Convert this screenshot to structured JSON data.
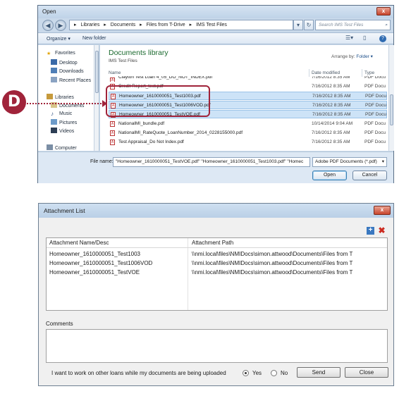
{
  "open_dialog": {
    "title": "Open",
    "close": "x",
    "address": [
      "Libraries",
      "Documents",
      "Files from T-Drive",
      "IMS Test Files"
    ],
    "search_placeholder": "Search IMS Test Files",
    "toolbar": {
      "organize": "Organize ▾",
      "new_folder": "New folder"
    },
    "nav": {
      "favorites": "Favorites",
      "desktop": "Desktop",
      "downloads": "Downloads",
      "recent": "Recent Places",
      "libraries": "Libraries",
      "documents": "Documents",
      "music": "Music",
      "pictures": "Pictures",
      "videos": "Videos",
      "computer": "Computer"
    },
    "library_title": "Documents library",
    "library_sub": "IMS Test Files",
    "arrange_label": "Arrange by:",
    "arrange_value": "Folder ▾",
    "columns": {
      "name": "Name",
      "date": "Date modified",
      "type": "Type"
    },
    "files": [
      {
        "name": "Clayton Test Loan 4_05_DO_NOT_INDEX.pdf",
        "date": "7/16/2012 8:35 AM",
        "type": "PDF Docu"
      },
      {
        "name": "Credit Report_test.pdf",
        "date": "7/16/2012 8:35 AM",
        "type": "PDF Docu"
      },
      {
        "name": "Homeowner_1610000051_Test1003.pdf",
        "date": "7/16/2012 8:35 AM",
        "type": "PDF Docu"
      },
      {
        "name": "Homeowner_1610000051_Test1006VOD.pdf",
        "date": "7/16/2012 8:35 AM",
        "type": "PDF Docu"
      },
      {
        "name": "Homeowner_1610000051_TestVOE.pdf",
        "date": "7/16/2012 8:35 AM",
        "type": "PDF Docu"
      },
      {
        "name": "NationalMI_bundle.pdf",
        "date": "10/14/2014 9:04 AM",
        "type": "PDF Docu"
      },
      {
        "name": "NationalMI_RateQuote_LoanNumber_2014_0228155000.pdf",
        "date": "7/16/2012 8:35 AM",
        "type": "PDF Docu"
      },
      {
        "name": "Test Appraisal_Do Not Index.pdf",
        "date": "7/16/2012 8:35 AM",
        "type": "PDF Docu"
      }
    ],
    "file_name_label": "File name:",
    "file_name_value": "\"Homeowner_1610000051_TestVOE.pdf\" \"Homeowner_1610000051_Test1003.pdf\" \"Homec",
    "file_type": "Adobe PDF Documents (*.pdf)",
    "open_btn": "Open",
    "cancel_btn": "Cancel"
  },
  "callout": "D",
  "attachment_list": {
    "title": "Attachment List",
    "close": "x",
    "headers": {
      "name": "Attachment Name/Desc",
      "path": "Attachment Path"
    },
    "rows": [
      {
        "name": "Homeowner_1610000051_Test1003",
        "path": "\\\\nmi.local\\files\\NMIDocs\\simon.attwood\\Documents\\Files from T"
      },
      {
        "name": "Homeowner_1610000051_Test1006VOD",
        "path": "\\\\nmi.local\\files\\NMIDocs\\simon.attwood\\Documents\\Files from T"
      },
      {
        "name": "Homeowner_1610000051_TestVOE",
        "path": "\\\\nmi.local\\files\\NMIDocs\\simon.attwood\\Documents\\Files from T"
      }
    ],
    "comments_label": "Comments",
    "work_label": "I want to work on other loans while my documents are being uploaded",
    "yes": "Yes",
    "no": "No",
    "send": "Send",
    "close_btn": "Close"
  },
  "colors": {
    "accent_callout": "#a0233a",
    "library_title": "#1b6a2f",
    "selection": "#cde3f7"
  }
}
